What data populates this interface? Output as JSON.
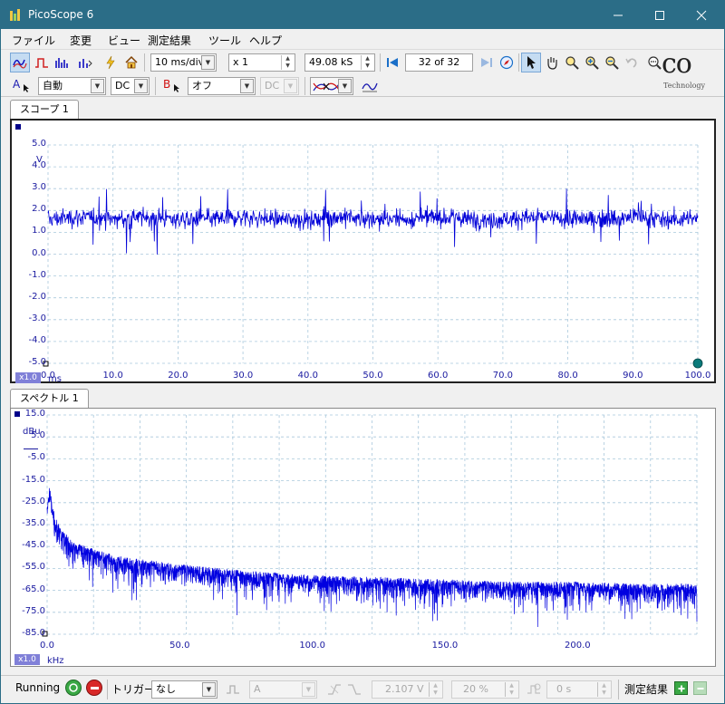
{
  "window": {
    "title": "PicoScope 6"
  },
  "menu": [
    "ファイル",
    "変更",
    "ビュー",
    "測定結果",
    "ツール",
    "ヘルプ"
  ],
  "toolbar": {
    "timebase": "10 ms/div",
    "zoom": "x 1",
    "samples": "49.08 kS",
    "buffer": "32 of 32"
  },
  "channels": {
    "a": {
      "label": "A",
      "range": "自動",
      "coupling": "DC"
    },
    "b": {
      "label": "B",
      "range": "オフ",
      "coupling": "DC"
    }
  },
  "logo": {
    "text": "co",
    "sub": "Technology"
  },
  "scope": {
    "tab": "スコープ 1",
    "unit": "V",
    "y_ticks": [
      "5.0",
      "4.0",
      "3.0",
      "2.0",
      "1.0",
      "0.0",
      "-1.0",
      "-2.0",
      "-3.0",
      "-4.0",
      "-5.0"
    ],
    "x_ticks": [
      "0.0",
      "10.0",
      "20.0",
      "30.0",
      "40.0",
      "50.0",
      "60.0",
      "70.0",
      "80.0",
      "90.0",
      "100.0"
    ],
    "x_unit": "ms",
    "scale": "x1.0"
  },
  "spectrum": {
    "tab": "スペクトル 1",
    "unit": "dBu",
    "y_ticks": [
      "15.0",
      "5.0",
      "-5.0",
      "-15.0",
      "-25.0",
      "-35.0",
      "-45.0",
      "-55.0",
      "-65.0",
      "-75.0",
      "-85.0"
    ],
    "x_ticks": [
      "0.0",
      "50.0",
      "100.0",
      "150.0",
      "200.0"
    ],
    "x_unit": "kHz",
    "scale": "x1.0"
  },
  "chart_data": [
    {
      "type": "line",
      "xlabel": "ms",
      "ylabel": "V",
      "xlim": [
        0,
        100
      ],
      "ylim": [
        -5,
        5
      ],
      "grid": true,
      "x": [
        0,
        5,
        10,
        15,
        20,
        25,
        30,
        35,
        40,
        45,
        50,
        55,
        60,
        65,
        70,
        75,
        80,
        85,
        90,
        95,
        100
      ],
      "series": [
        {
          "values": [
            1.6,
            1.7,
            1.6,
            1.7,
            1.6,
            1.6,
            1.7,
            1.6,
            1.6,
            1.7,
            1.6,
            1.6,
            1.7,
            1.6,
            1.6,
            1.7,
            1.6,
            1.6,
            1.7,
            1.6,
            1.6
          ]
        }
      ]
    },
    {
      "type": "line",
      "xlabel": "kHz",
      "ylabel": "dBu",
      "xlim": [
        0,
        245
      ],
      "ylim": [
        -85,
        15
      ],
      "grid": true,
      "x": [
        0,
        1,
        2,
        5,
        10,
        20,
        30,
        50,
        75,
        100,
        125,
        150,
        175,
        200,
        225,
        245
      ],
      "series": [
        {
          "values": [
            -30,
            -22,
            -32,
            -42,
            -48,
            -52,
            -55,
            -58,
            -61,
            -63,
            -64,
            -65,
            -66,
            -66,
            -67,
            -67
          ]
        }
      ]
    }
  ],
  "status": {
    "run_label": "Running",
    "trigger_label": "トリガー",
    "trigger_mode": "なし",
    "trigger_source": "A",
    "threshold": "2.107 V",
    "pre_trigger": "20 %",
    "delay": "0 s",
    "measure_label": "測定結果"
  }
}
